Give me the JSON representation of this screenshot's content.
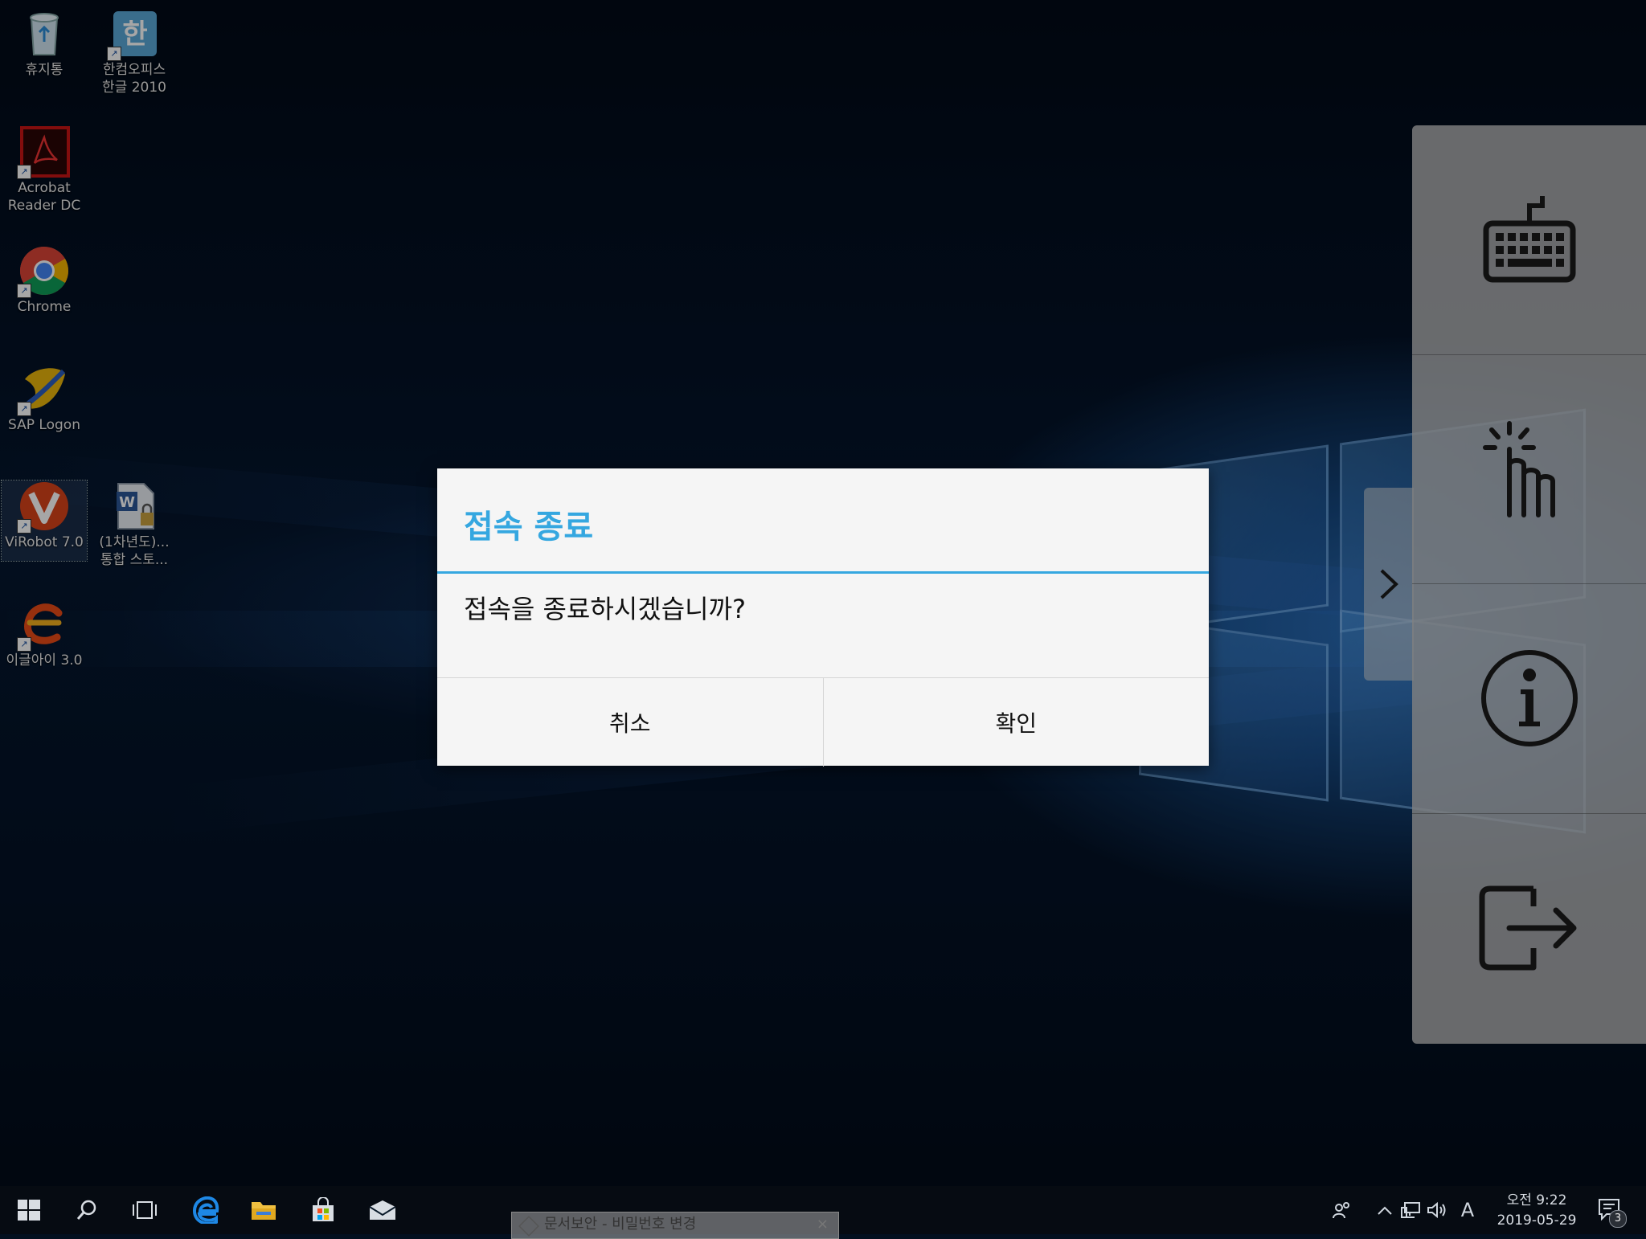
{
  "desktop": {
    "icons": [
      {
        "label": "휴지통",
        "icon": "recycle-bin-icon"
      },
      {
        "label": "한컴오피스\n한글 2010",
        "icon": "hancom-office-icon"
      },
      {
        "label": "Acrobat\nReader DC",
        "icon": "acrobat-reader-icon"
      },
      {
        "label": "Chrome",
        "icon": "chrome-icon"
      },
      {
        "label": "SAP Logon",
        "icon": "sap-logon-icon"
      },
      {
        "label": "ViRobot 7.0",
        "icon": "virobot-icon"
      },
      {
        "label": "(1차년도)...\n통합 스토...",
        "icon": "word-document-icon"
      },
      {
        "label": "이글아이 3.0",
        "icon": "eagle-eye-icon"
      }
    ]
  },
  "toolbar": {
    "buttons": [
      {
        "icon": "keyboard-icon"
      },
      {
        "icon": "touch-pointer-icon"
      },
      {
        "icon": "info-icon"
      },
      {
        "icon": "exit-icon"
      }
    ],
    "handle_icon": "chevron-right-icon"
  },
  "dialog": {
    "title": "접속 종료",
    "message": "접속을 종료하시겠습니까?",
    "cancel_label": "취소",
    "confirm_label": "확인",
    "accent_color": "#35a7e0"
  },
  "taskbar": {
    "pinned": [
      "start-icon",
      "search-icon",
      "task-view-icon",
      "edge-icon",
      "file-explorer-icon",
      "store-icon",
      "mail-icon"
    ],
    "active_window": "문서보안 - 비밀번호 변경",
    "tray": {
      "ime_label": "A",
      "clock_time": "오전 9:22",
      "clock_date": "2019-05-29",
      "notification_count": "3"
    }
  }
}
